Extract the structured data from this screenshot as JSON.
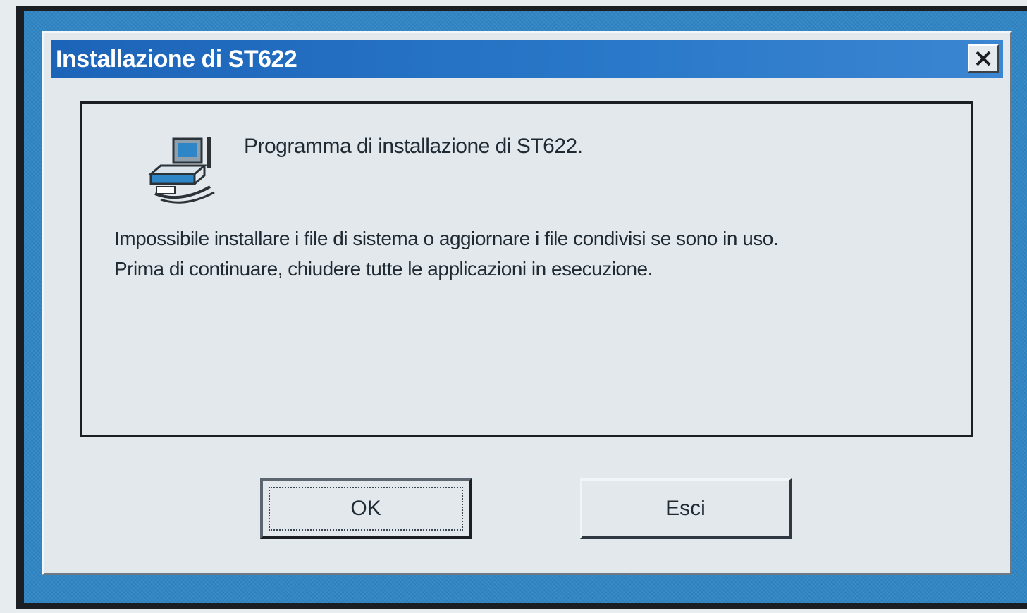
{
  "window": {
    "title": "Installazione di ST622"
  },
  "content": {
    "heading": "Programma di installazione di ST622.",
    "message_lines": [
      "Impossibile installare i file di sistema o aggiornare i file condivisi se sono in uso.",
      "Prima di continuare, chiudere tutte le applicazioni in esecuzione."
    ],
    "icon": "setup-computer-icon"
  },
  "buttons": {
    "ok_label": "OK",
    "exit_label": "Esci"
  },
  "colors": {
    "titlebar": "#1c64b8",
    "dialog_face": "#e3e8ec",
    "desktop": "#2f86c6"
  }
}
